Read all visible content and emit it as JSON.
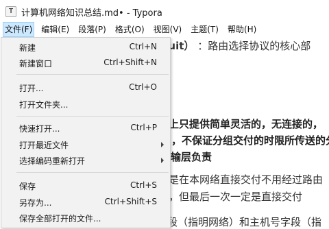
{
  "window": {
    "title": "计算机网络知识总结.md• - Typora",
    "app_icon_letter": "T"
  },
  "menubar": [
    {
      "label": "文件(F)",
      "active": true
    },
    {
      "label": "编辑(E)"
    },
    {
      "label": "段落(P)"
    },
    {
      "label": "格式(O)"
    },
    {
      "label": "视图(V)"
    },
    {
      "label": "主题(T)"
    },
    {
      "label": "帮助(H)"
    }
  ],
  "file_menu": {
    "items": [
      {
        "label": "新建",
        "shortcut": "Ctrl+N"
      },
      {
        "label": "新建窗口",
        "shortcut": "Ctrl+Shift+N"
      },
      {
        "label": "打开...",
        "shortcut": "Ctrl+O"
      },
      {
        "label": "打开文件夹...",
        "shortcut": ""
      },
      {
        "label": "快速打开...",
        "shortcut": "Ctrl+P"
      },
      {
        "label": "打开最近文件",
        "shortcut": "",
        "submenu": true
      },
      {
        "label": "选择编码重新打开",
        "shortcut": "",
        "submenu": true
      },
      {
        "label": "保存",
        "shortcut": "Ctrl+S"
      },
      {
        "label": "另存为...",
        "shortcut": "Ctrl+Shift+S"
      },
      {
        "label": "保存全部打开的文件...",
        "shortcut": ""
      }
    ]
  },
  "document": {
    "lines": [
      {
        "text": "ircuit） ：路由选择协议的核心部",
        "bold_prefix": "ircuit）"
      },
      {
        "text": "上只提供简单灵活的，无连接的，",
        "bold": true
      },
      {
        "text": "，不保证分组交付的时限所传送的分",
        "bold": true
      },
      {
        "text": "运输层负责",
        "bold": true
      },
      {
        "text": "是在本网络直接交付不用经过路由"
      },
      {
        "text": "，但最后一次一定是直接交付"
      },
      {
        "text": "段（指明网络）和主机号字段（指"
      }
    ]
  },
  "colors": {
    "menu_background": "#f2f2f2",
    "menubar_active_background": "#cce8ff",
    "menubar_active_border": "#99d1ff"
  }
}
